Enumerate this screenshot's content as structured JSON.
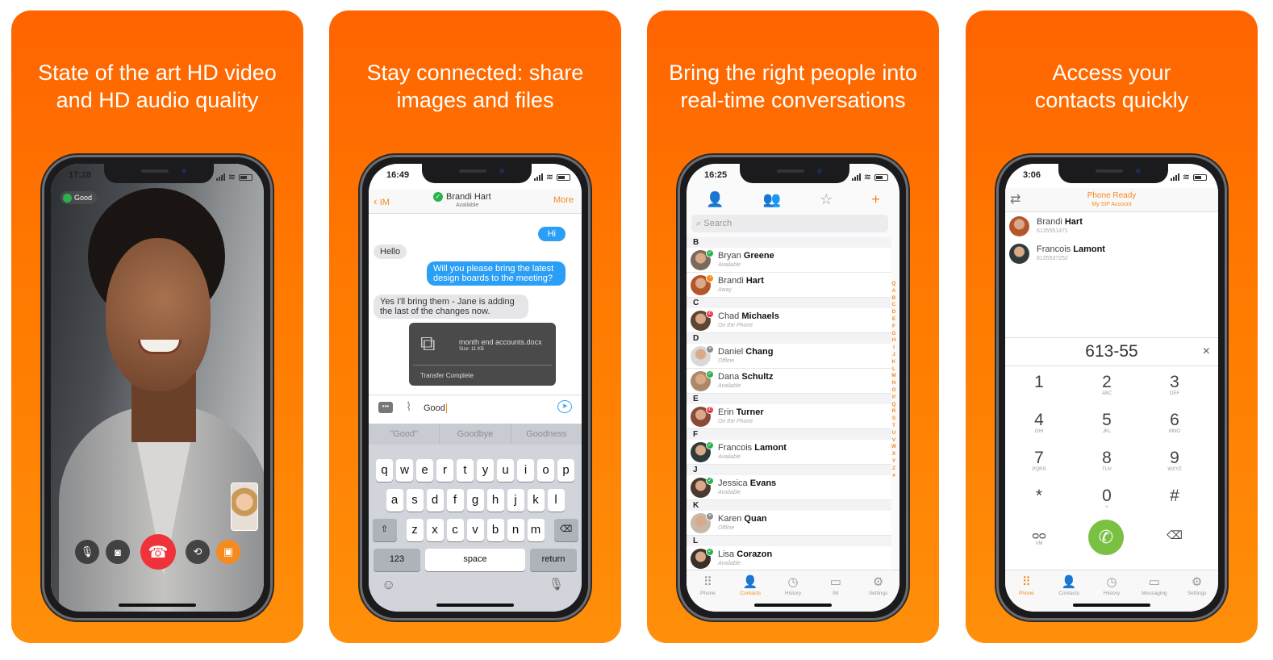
{
  "colors": {
    "accent": "#f58b1f",
    "panel_bg": "#ff7a00",
    "bubble_me": "#2a9ff5",
    "call_green": "#7ac143",
    "end_red": "#f0323a",
    "available": "#2bb24c"
  },
  "panels": [
    {
      "title_lines": [
        "State of the art HD video",
        "and HD audio quality"
      ]
    },
    {
      "title_lines": [
        "Stay connected: share",
        "images and files"
      ]
    },
    {
      "title_lines": [
        "Bring the right people into",
        "real-time conversations"
      ]
    },
    {
      "title_lines": [
        "Access your",
        "contacts quickly"
      ]
    }
  ],
  "video_call": {
    "time": "17:28",
    "quality_badge": "Good",
    "controls": [
      {
        "icon": "microphone-icon",
        "glyph": "🎙"
      },
      {
        "icon": "camera-off-icon",
        "glyph": "◙"
      },
      {
        "icon": "end-call-icon",
        "glyph": "☎"
      },
      {
        "icon": "switch-camera-icon",
        "glyph": "⟲"
      },
      {
        "icon": "share-screen-icon",
        "glyph": "▣"
      }
    ]
  },
  "chat": {
    "time": "16:49",
    "back_label": "IM",
    "contact_name": "Brandi Hart",
    "contact_status": "Available",
    "more_label": "More",
    "messages": [
      {
        "from": "me",
        "text": "Hi"
      },
      {
        "from": "them",
        "text": "Hello"
      },
      {
        "from": "me",
        "text": "Will you please bring the latest design boards to the meeting?"
      },
      {
        "from": "them",
        "text": "Yes I'll bring them - Jane is adding the last of the changes now."
      }
    ],
    "file": {
      "name": "month end accounts.docx",
      "size": "Size: 11 KB",
      "status": "Transfer Complete"
    },
    "input_value": "Good",
    "suggestions": [
      "\"Good\"",
      "Goodbye",
      "Goodness"
    ],
    "keyboard_rows": [
      [
        "q",
        "w",
        "e",
        "r",
        "t",
        "y",
        "u",
        "i",
        "o",
        "p"
      ],
      [
        "a",
        "s",
        "d",
        "f",
        "g",
        "h",
        "j",
        "k",
        "l"
      ],
      [
        "z",
        "x",
        "c",
        "v",
        "b",
        "n",
        "m"
      ]
    ],
    "key_123": "123",
    "key_space": "space",
    "key_return": "return"
  },
  "contacts": {
    "time": "16:25",
    "search_placeholder": "Search",
    "sections": [
      {
        "letter": "B",
        "items": [
          {
            "first": "Bryan",
            "last": "Greene",
            "status": "Available",
            "state": "available"
          },
          {
            "first": "Brandi",
            "last": "Hart",
            "status": "Away",
            "state": "away"
          }
        ]
      },
      {
        "letter": "C",
        "items": [
          {
            "first": "Chad",
            "last": "Michaels",
            "status": "On the Phone",
            "state": "phone"
          }
        ]
      },
      {
        "letter": "D",
        "items": [
          {
            "first": "Daniel",
            "last": "Chang",
            "status": "Offline",
            "state": "offline"
          },
          {
            "first": "Dana",
            "last": "Schultz",
            "status": "Available",
            "state": "available"
          }
        ]
      },
      {
        "letter": "E",
        "items": [
          {
            "first": "Erin",
            "last": "Turner",
            "status": "On the Phone",
            "state": "phone"
          }
        ]
      },
      {
        "letter": "F",
        "items": [
          {
            "first": "Francois",
            "last": "Lamont",
            "status": "Available",
            "state": "available"
          }
        ]
      },
      {
        "letter": "J",
        "items": [
          {
            "first": "Jessica",
            "last": "Evans",
            "status": "Available",
            "state": "available"
          }
        ]
      },
      {
        "letter": "K",
        "items": [
          {
            "first": "Karen",
            "last": "Quan",
            "status": "Offline",
            "state": "offline"
          }
        ]
      },
      {
        "letter": "L",
        "items": [
          {
            "first": "Lisa",
            "last": "Corazon",
            "status": "Available",
            "state": "available"
          }
        ]
      }
    ],
    "index_letters": [
      "Q",
      "A",
      "B",
      "C",
      "D",
      "E",
      "F",
      "G",
      "H",
      "I",
      "J",
      "K",
      "L",
      "M",
      "N",
      "O",
      "P",
      "Q",
      "R",
      "S",
      "T",
      "U",
      "V",
      "W",
      "X",
      "Y",
      "Z",
      "#"
    ],
    "tabs": [
      {
        "label": "Phone",
        "icon": "dialpad-icon",
        "glyph": "⠿"
      },
      {
        "label": "Contacts",
        "icon": "contacts-icon",
        "glyph": "👤",
        "active": true
      },
      {
        "label": "History",
        "icon": "history-icon",
        "glyph": "◷"
      },
      {
        "label": "IM",
        "icon": "chat-icon",
        "glyph": "▭"
      },
      {
        "label": "Settings",
        "icon": "settings-icon",
        "glyph": "⚙"
      }
    ]
  },
  "dialer": {
    "time": "3:06",
    "status_title": "Phone Ready",
    "account": "My SIP Account",
    "recents": [
      {
        "first": "Brandi",
        "last": "Hart",
        "number": "6135551471"
      },
      {
        "first": "Francois",
        "last": "Lamont",
        "number": "6135537252"
      }
    ],
    "dialed_number": "613-55",
    "keys": [
      {
        "n": "1",
        "l": ""
      },
      {
        "n": "2",
        "l": "ABC"
      },
      {
        "n": "3",
        "l": "DEF"
      },
      {
        "n": "4",
        "l": "GHI"
      },
      {
        "n": "5",
        "l": "JKL"
      },
      {
        "n": "6",
        "l": "MNO"
      },
      {
        "n": "7",
        "l": "PQRS"
      },
      {
        "n": "8",
        "l": "TUV"
      },
      {
        "n": "9",
        "l": "WXYZ"
      },
      {
        "n": "*",
        "l": ""
      },
      {
        "n": "0",
        "l": "+"
      },
      {
        "n": "#",
        "l": ""
      }
    ],
    "voicemail_label": "VM",
    "tabs": [
      {
        "label": "Phone",
        "icon": "dialpad-icon",
        "glyph": "⠿",
        "active": true
      },
      {
        "label": "Contacts",
        "icon": "contacts-icon",
        "glyph": "👤"
      },
      {
        "label": "History",
        "icon": "history-icon",
        "glyph": "◷"
      },
      {
        "label": "Messaging",
        "icon": "messaging-icon",
        "glyph": "▭"
      },
      {
        "label": "Settings",
        "icon": "settings-icon",
        "glyph": "⚙"
      }
    ]
  }
}
